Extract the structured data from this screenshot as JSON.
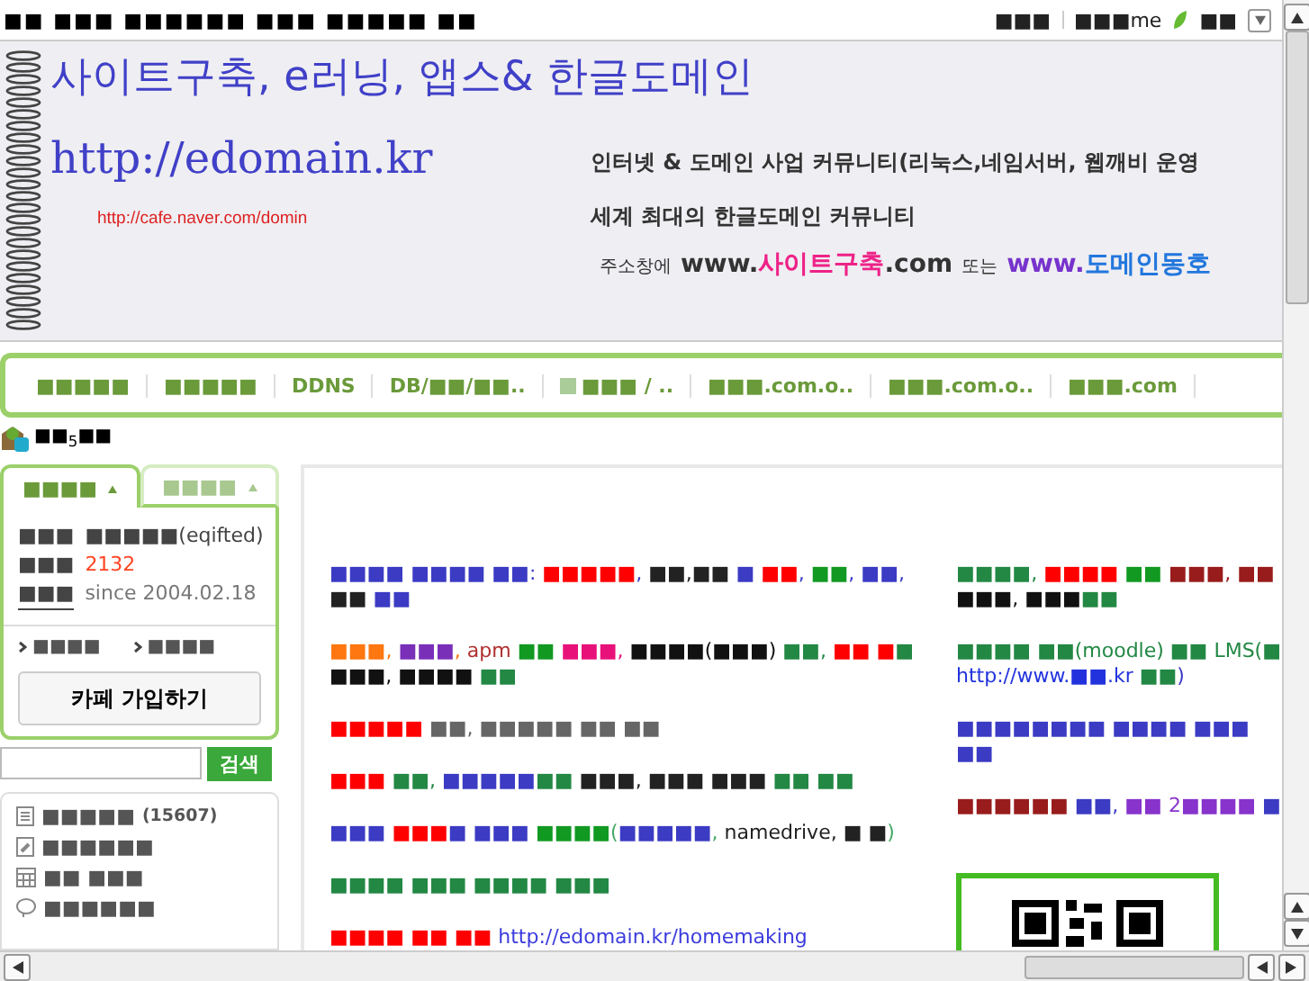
{
  "top_bar": {
    "title": "■■ ■■■ ■■■■■■ ■■■ ■■■■■ ■■",
    "links": [
      {
        "text": "■■■",
        "kind": "plain"
      },
      {
        "text": "■■■me",
        "kind": "plain"
      },
      {
        "text": "■■",
        "kind": "leaf"
      }
    ]
  },
  "banner": {
    "title": "사이트구축, e러닝, 앱스& 한글도메인",
    "url": "http://edomain.kr",
    "cafe_link": "http://cafe.naver.com/domin",
    "lines": [
      "인터넷 & 도메인 사업 커뮤니티(리눅스,네임서버, 웹깨비 운영",
      "세계 최대의 한글도메인 커뮤니티"
    ],
    "address_line": [
      {
        "text": "주소창에",
        "kind": "small",
        "color": "#333333"
      },
      {
        "text": "www.",
        "kind": "large",
        "color": "#333333"
      },
      {
        "text": "사이트구축",
        "kind": "large",
        "color": "#ee2288"
      },
      {
        "text": ".com",
        "kind": "large",
        "color": "#333333"
      },
      {
        "text": "또는",
        "kind": "small",
        "color": "#333333"
      },
      {
        "text": "www.",
        "kind": "large",
        "color": "#7733cc"
      },
      {
        "text": "도메인동호",
        "kind": "large",
        "color": "#2277dd"
      }
    ]
  },
  "nav": [
    {
      "label": "■■■■■",
      "kind": "plain"
    },
    {
      "label": "■■■■■",
      "kind": "plain"
    },
    {
      "label": "DDNS",
      "kind": "plain"
    },
    {
      "label": "DB/■■/■■..",
      "kind": "plain"
    },
    {
      "label": "■■■ / ..",
      "kind": "icon"
    },
    {
      "label": "■■■.com.o..",
      "kind": "plain"
    },
    {
      "label": "■■■.com.o..",
      "kind": "plain"
    },
    {
      "label": "■■■.com",
      "kind": "plain"
    }
  ],
  "level": "■■$_{5}$■■",
  "sidebar": {
    "tabs": [
      {
        "label": "■■■■",
        "selected": true
      },
      {
        "label": "■■■■",
        "selected": false
      }
    ],
    "info": [
      {
        "label": "■■■",
        "value": "■■■■■(eqifted)",
        "color": "#444444"
      },
      {
        "label": "■■■",
        "value": "2132",
        "color": "#ff4422"
      },
      {
        "label": "■■■",
        "value": "since 2004.02.18",
        "color": "#777777"
      }
    ],
    "links": [
      "■■■■",
      "■■■■"
    ],
    "join_button": "카페 가입하기",
    "search_button": "검색",
    "menu": [
      {
        "text": "■■■■■",
        "count": "(15607)",
        "kind": "list"
      },
      {
        "text": "■■■■■■",
        "kind": "clip"
      },
      {
        "text": "■■ ■■■",
        "kind": "calendar"
      },
      {
        "text": "■■■■■■",
        "kind": "bubble"
      }
    ]
  },
  "content": {
    "left": [
      [
        {
          "text": "■■■■ ■■■■ ■■",
          "color": "#3b3bc4"
        },
        {
          "text": ": ",
          "color": "#3b3bc4"
        },
        {
          "text": "■■■■■",
          "color": "#ff0000"
        },
        {
          "text": ", ",
          "color": "#3b3bc4"
        },
        {
          "text": "■■,■■ ",
          "color": "#222222"
        },
        {
          "text": "■ ",
          "color": "#3b3bc4"
        },
        {
          "text": "■■",
          "color": "#ff0000"
        },
        {
          "text": ", ",
          "color": "#3b3bc4"
        },
        {
          "text": "■■",
          "color": "#119922"
        },
        {
          "text": ", ",
          "color": "#3b3bc4"
        },
        {
          "text": "■■",
          "color": "#3b3bc4"
        },
        {
          "text": ", ",
          "color": "#3b3bc4"
        },
        {
          "text": "■■ ",
          "color": "#222222"
        },
        {
          "text": "■■",
          "color": "#3b3bc4"
        }
      ],
      [
        {
          "text": "■■■",
          "color": "#ff7711"
        },
        {
          "text": ", ",
          "color": "#ff7711"
        },
        {
          "text": "■■■",
          "color": "#7a2fb8"
        },
        {
          "text": ", ",
          "color": "#ff7711"
        },
        {
          "text": "apm ",
          "color": "#b03030"
        },
        {
          "text": "■■ ",
          "color": "#119922"
        },
        {
          "text": "■■■",
          "color": "#e8117a"
        },
        {
          "text": ", ",
          "color": "#e8117a"
        },
        {
          "text": "■■■■(■■■) ",
          "color": "#111111"
        },
        {
          "text": "■■",
          "color": "#228844"
        },
        {
          "text": ", ",
          "color": "#228844"
        },
        {
          "text": "■■ ■",
          "color": "#ff0000"
        },
        {
          "text": "■ ",
          "color": "#228844"
        },
        {
          "text": "■■■, ■■■■ ",
          "color": "#111111"
        },
        {
          "text": "■■",
          "color": "#228844"
        }
      ],
      [
        {
          "text": "■■■■■ ",
          "color": "#ff0000"
        },
        {
          "text": "■■, ■■■■■ ■■ ■■",
          "color": "#666666"
        }
      ],
      [
        {
          "text": "■■■ ",
          "color": "#ff0000"
        },
        {
          "text": "■■, ",
          "color": "#228844"
        },
        {
          "text": "■■■■■",
          "color": "#3b3bc4"
        },
        {
          "text": "■■ ",
          "color": "#228844"
        },
        {
          "text": "■■■, ■■■ ■■■ ",
          "color": "#222222"
        },
        {
          "text": "■■ ■■",
          "color": "#228844"
        }
      ],
      [
        {
          "text": "■■■ ",
          "color": "#3b3bc4"
        },
        {
          "text": "■■■",
          "color": "#ff0000"
        },
        {
          "text": "■ ■■■ ",
          "color": "#3b3bc4"
        },
        {
          "text": "■■■■",
          "color": "#119922"
        },
        {
          "text": "(",
          "color": "#44aa66"
        },
        {
          "text": "■■■■■",
          "color": "#3b3bc4"
        },
        {
          "text": ", ",
          "color": "#44aa66"
        },
        {
          "text": "namedrive, ■ ■",
          "color": "#222222"
        },
        {
          "text": ")",
          "color": "#44aa66"
        }
      ],
      [
        {
          "text": "■■■■ ■■■ ■■■■  ■■■",
          "color": "#228844"
        }
      ],
      [
        {
          "text": "■■■■ ■■ ■■   ",
          "color": "#ff0000"
        },
        {
          "text": "http://edomain.kr/homemaking",
          "color": "#3b3bdd"
        }
      ]
    ],
    "right": [
      [
        {
          "text": "■■■■",
          "color": "#228844"
        },
        {
          "text": ", ",
          "color": "#228844"
        },
        {
          "text": "■■■■ ",
          "color": "#ff0000"
        },
        {
          "text": "■■ ",
          "color": "#119922"
        },
        {
          "text": "■■■",
          "color": "#991c1c"
        },
        {
          "text": ", ",
          "color": "#991c1c"
        },
        {
          "text": "■■ ",
          "color": "#991c1c"
        },
        {
          "text": "■■■, ■■■",
          "color": "#111111"
        },
        {
          "text": "■■",
          "color": "#228844"
        }
      ],
      [
        {
          "text": "■■■■ ■■(moodle) ■■ LMS(■ ",
          "color": "#228844"
        },
        {
          "text": "http://www.■■.kr ",
          "color": "#2233dd"
        },
        {
          "text": "■■",
          "color": "#228844"
        },
        {
          "text": ")",
          "color": "#3b3bc4"
        }
      ],
      [
        {
          "text": "■■■■■■■■ ■■■■ ■■■ ■■",
          "color": "#3b3bc4"
        }
      ],
      [
        {
          "text": "■■■■■■ ",
          "color": "#991c1c"
        },
        {
          "text": "■■",
          "color": "#3b3bc4"
        },
        {
          "text": ", ",
          "color": "#3b3bc4"
        },
        {
          "text": "■■ 2■■■■ ",
          "color": "#8833cc"
        },
        {
          "text": "■",
          "color": "#3b3bc4"
        }
      ]
    ]
  }
}
